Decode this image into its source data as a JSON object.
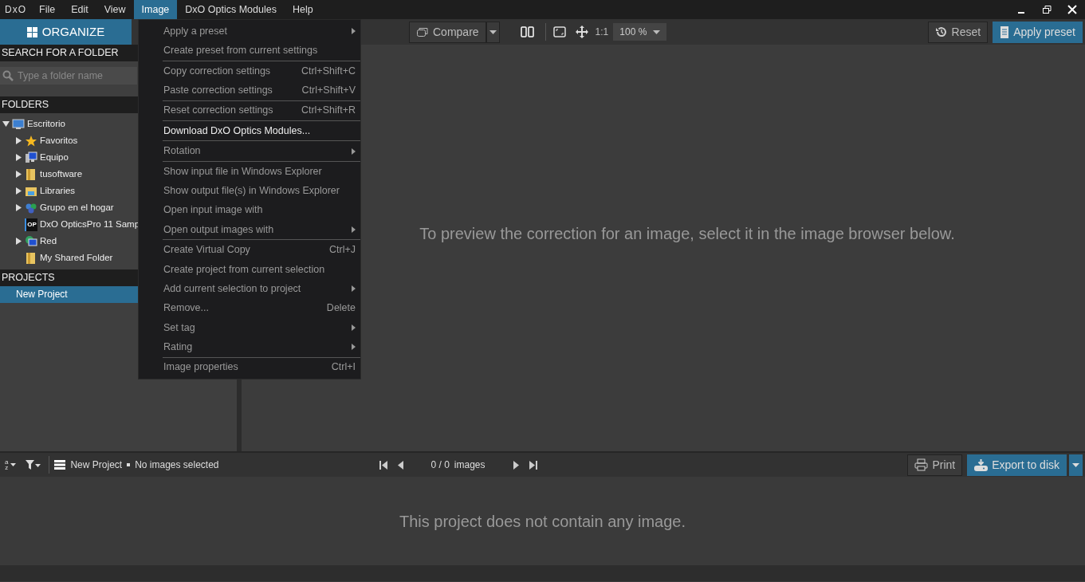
{
  "app": {
    "logo": "DxO"
  },
  "menu_bar": [
    {
      "label": "File",
      "selected": false
    },
    {
      "label": "Edit",
      "selected": false
    },
    {
      "label": "View",
      "selected": false
    },
    {
      "label": "Image",
      "selected": true
    },
    {
      "label": "DxO Optics Modules",
      "selected": false
    },
    {
      "label": "Help",
      "selected": false
    }
  ],
  "open_menu": {
    "groups": [
      [
        {
          "label": "Apply a preset",
          "submenu": true,
          "disabled": true
        },
        {
          "label": "Create preset from current settings",
          "disabled": true
        }
      ],
      [
        {
          "label": "Copy correction settings",
          "shortcut": "Ctrl+Shift+C",
          "disabled": true
        },
        {
          "label": "Paste correction settings",
          "shortcut": "Ctrl+Shift+V",
          "disabled": true
        }
      ],
      [
        {
          "label": "Reset correction settings",
          "shortcut": "Ctrl+Shift+R",
          "disabled": true
        }
      ],
      [
        {
          "label": "Download DxO Optics Modules...",
          "disabled": false
        }
      ],
      [
        {
          "label": "Rotation",
          "submenu": true,
          "disabled": true
        }
      ],
      [
        {
          "label": "Show input file in Windows Explorer",
          "disabled": true
        },
        {
          "label": "Show output file(s) in Windows Explorer",
          "disabled": true
        },
        {
          "label": "Open input image with",
          "disabled": true
        },
        {
          "label": "Open output images with",
          "submenu": true,
          "disabled": true
        }
      ],
      [
        {
          "label": "Create Virtual Copy",
          "shortcut": "Ctrl+J",
          "disabled": true
        },
        {
          "label": "Create project from current selection",
          "disabled": true
        },
        {
          "label": "Add current selection to project",
          "submenu": true,
          "disabled": true
        },
        {
          "label": "Remove...",
          "shortcut": "Delete",
          "disabled": true
        },
        {
          "label": "Set tag",
          "submenu": true,
          "disabled": true
        },
        {
          "label": "Rating",
          "submenu": true,
          "disabled": true
        }
      ],
      [
        {
          "label": "Image properties",
          "shortcut": "Ctrl+I",
          "disabled": true
        }
      ]
    ]
  },
  "sidebar": {
    "organize_button": "ORGANIZE",
    "search_heading": "SEARCH FOR A FOLDER",
    "search": {
      "placeholder": "Type a folder name"
    },
    "folders_heading": "FOLDERS",
    "folders": [
      {
        "label": "Escritorio",
        "kind": "desktop",
        "expanded": true,
        "children": [
          {
            "label": "Favoritos",
            "kind": "star",
            "expanded": false
          },
          {
            "label": "Equipo",
            "kind": "computer",
            "expanded": false
          },
          {
            "label": "tusoftware",
            "kind": "folder",
            "expanded": false
          },
          {
            "label": "Libraries",
            "kind": "library",
            "expanded": false
          },
          {
            "label": "Grupo en el hogar",
            "kind": "homegroup",
            "expanded": false
          },
          {
            "label": "DxO OpticsPro 11 Samp",
            "kind": "app",
            "icon_text": "OP"
          },
          {
            "label": "Red",
            "kind": "network",
            "expanded": false
          },
          {
            "label": "My Shared Folder",
            "kind": "folder"
          }
        ]
      }
    ],
    "projects_heading": "PROJECTS",
    "projects": [
      {
        "label": "New Project",
        "selected": true
      }
    ]
  },
  "toolbar": {
    "compare": "Compare",
    "one_to_one": "1:1",
    "zoom": "100 %",
    "reset": "Reset",
    "apply_preset": "Apply preset"
  },
  "viewer": {
    "message": "To preview the correction for an image, select it in the image browser below."
  },
  "browser_bar": {
    "sort_letters": [
      "a",
      "z"
    ],
    "project": "New Project",
    "selection": "No images selected",
    "counter": "0 / 0",
    "counter_unit": "images",
    "print": "Print",
    "export": "Export to disk"
  },
  "browser": {
    "message": "This project does not contain any image."
  }
}
